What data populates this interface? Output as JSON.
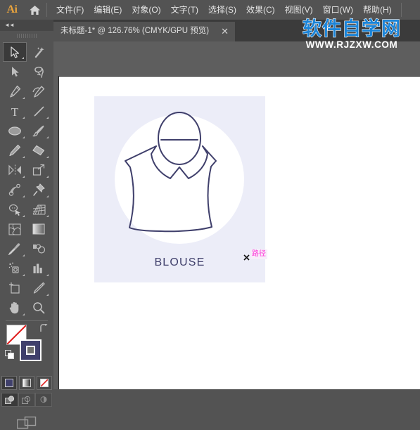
{
  "app": {
    "name": "Adobe Illustrator",
    "logo_text": "Ai"
  },
  "menubar": {
    "home_icon": "home-icon",
    "items": [
      {
        "label": "文件(F)"
      },
      {
        "label": "编辑(E)"
      },
      {
        "label": "对象(O)"
      },
      {
        "label": "文字(T)"
      },
      {
        "label": "选择(S)"
      },
      {
        "label": "效果(C)"
      },
      {
        "label": "视图(V)"
      },
      {
        "label": "窗口(W)"
      },
      {
        "label": "帮助(H)"
      }
    ]
  },
  "tabbar": {
    "document_title": "未标题-1* @ 126.76% (CMYK/GPU 预览)",
    "close_label": "✕"
  },
  "toolbar": {
    "collapse_label": "◄◄",
    "tools": [
      {
        "name": "selection-tool",
        "icon": "arrow-solid-outline",
        "active": true,
        "has_flyout": true
      },
      {
        "name": "magic-wand-tool",
        "icon": "magic-wand",
        "active": false,
        "has_flyout": false
      },
      {
        "name": "direct-selection-tool",
        "icon": "arrow-filled",
        "active": false,
        "has_flyout": true
      },
      {
        "name": "lasso-tool",
        "icon": "lasso",
        "active": false,
        "has_flyout": false
      },
      {
        "name": "pen-tool",
        "icon": "pen-nib",
        "active": false,
        "has_flyout": true
      },
      {
        "name": "curvature-tool",
        "icon": "curvature-pen",
        "active": false,
        "has_flyout": false
      },
      {
        "name": "type-tool",
        "icon": "type-t",
        "active": false,
        "has_flyout": true
      },
      {
        "name": "line-segment-tool",
        "icon": "diagonal-line",
        "active": false,
        "has_flyout": true
      },
      {
        "name": "ellipse-tool",
        "icon": "ellipse",
        "active": false,
        "has_flyout": true
      },
      {
        "name": "paintbrush-tool",
        "icon": "paintbrush",
        "active": false,
        "has_flyout": true
      },
      {
        "name": "shaper-pencil-tool",
        "icon": "pencil",
        "active": false,
        "has_flyout": true
      },
      {
        "name": "eraser-tool",
        "icon": "eraser",
        "active": false,
        "has_flyout": true
      },
      {
        "name": "rotate-reflect-tool",
        "icon": "reflect",
        "active": false,
        "has_flyout": true
      },
      {
        "name": "scale-tool",
        "icon": "scale-box",
        "active": false,
        "has_flyout": true
      },
      {
        "name": "width-warp-tool",
        "icon": "warp",
        "active": false,
        "has_flyout": true
      },
      {
        "name": "free-transform-tool",
        "icon": "push-pin",
        "active": false,
        "has_flyout": true
      },
      {
        "name": "shape-builder-tool",
        "icon": "shape-builder",
        "active": false,
        "has_flyout": true
      },
      {
        "name": "perspective-grid-tool",
        "icon": "perspective-grid",
        "active": false,
        "has_flyout": true
      },
      {
        "name": "mesh-tool",
        "icon": "mesh",
        "active": false,
        "has_flyout": false
      },
      {
        "name": "gradient-tool",
        "icon": "gradient-square",
        "active": false,
        "has_flyout": false
      },
      {
        "name": "eyedropper-tool",
        "icon": "eyedropper",
        "active": false,
        "has_flyout": true
      },
      {
        "name": "blend-tool",
        "icon": "blend",
        "active": false,
        "has_flyout": false
      },
      {
        "name": "symbol-sprayer-tool",
        "icon": "symbol-sprayer",
        "active": false,
        "has_flyout": true
      },
      {
        "name": "column-graph-tool",
        "icon": "bar-chart",
        "active": false,
        "has_flyout": true
      },
      {
        "name": "artboard-tool",
        "icon": "artboard",
        "active": false,
        "has_flyout": false
      },
      {
        "name": "slice-tool",
        "icon": "slice-knife",
        "active": false,
        "has_flyout": true
      },
      {
        "name": "hand-tool",
        "icon": "hand",
        "active": false,
        "has_flyout": true
      },
      {
        "name": "zoom-tool",
        "icon": "magnifier",
        "active": false,
        "has_flyout": false
      }
    ],
    "color_controls": {
      "fill_color": "#ffffff",
      "fill_is_none": true,
      "stroke_color": "#3f3f6b",
      "swap_icon": "swap-arrow-icon",
      "default_icon": "default-colors-icon"
    },
    "paint_modes": [
      {
        "name": "color-mode-solid",
        "selected": true
      },
      {
        "name": "color-mode-gradient",
        "selected": false
      },
      {
        "name": "color-mode-none",
        "selected": false
      }
    ],
    "draw_modes": [
      {
        "name": "draw-normal-mode",
        "selected": true
      },
      {
        "name": "draw-behind-mode",
        "selected": false
      },
      {
        "name": "draw-inside-mode",
        "selected": false
      }
    ],
    "screen_mode": {
      "name": "change-screen-mode",
      "icon": "screen-mode-icon"
    }
  },
  "canvas": {
    "artwork": {
      "card_background": "#ecedf8",
      "circle_color": "#ffffff",
      "stroke_color": "#3f3f6b",
      "label": "BLOUSE",
      "subject": "sleeveless-blouse-with-collar"
    },
    "cursor": {
      "icon": "crosshair-x-cursor",
      "tooltip": "路径",
      "tooltip_color": "#ff2fd6"
    }
  },
  "watermark": {
    "chinese": "软件自学网",
    "url": "WWW.RJZXW.COM",
    "color": "#1b84d8"
  }
}
